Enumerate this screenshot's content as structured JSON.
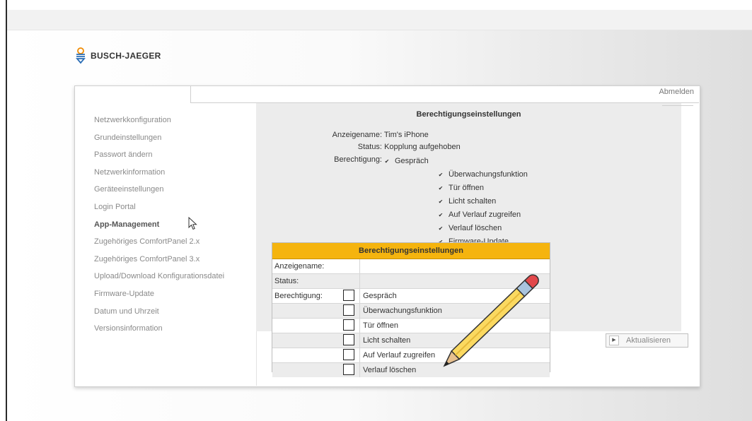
{
  "brand": {
    "name": "BUSCH-JAEGER"
  },
  "header": {
    "logout_label": "Abmelden"
  },
  "sidebar": {
    "items": [
      {
        "label": "Netzwerkkonfiguration"
      },
      {
        "label": "Grundeinstellungen"
      },
      {
        "label": "Passwort ändern"
      },
      {
        "label": "Netzwerkinformation"
      },
      {
        "label": "Geräteeinstellungen"
      },
      {
        "label": "Login Portal"
      },
      {
        "label": "App-Management",
        "active": true
      },
      {
        "label": "Zugehöriges ComfortPanel 2.x"
      },
      {
        "label": "Zugehöriges ComfortPanel 3.x"
      },
      {
        "label": "Upload/Download Konfigurationsdatei"
      },
      {
        "label": "Firmware-Update"
      },
      {
        "label": "Datum und Uhrzeit"
      },
      {
        "label": "Versionsinformation"
      }
    ]
  },
  "main": {
    "title": "Berechtigungseinstellungen",
    "display_name_label": "Anzeigename:",
    "display_name_value": "Tim's iPhone",
    "status_label": "Status:",
    "status_value": "Kopplung aufgehoben",
    "permission_label": "Berechtigung:",
    "permissions": [
      {
        "label": "Gespräch",
        "checked": true
      },
      {
        "label": "Überwachungsfunktion",
        "checked": true
      },
      {
        "label": "Tür öffnen",
        "checked": true
      },
      {
        "label": "Licht schalten",
        "checked": true
      },
      {
        "label": "Auf Verlauf zugreifen",
        "checked": true
      },
      {
        "label": "Verlauf löschen",
        "checked": true
      },
      {
        "label": "Firmware-Update",
        "checked": true
      }
    ],
    "refresh_label": "Aktualisieren"
  },
  "overlay_table": {
    "title": "Berechtigungseinstellungen",
    "rows": [
      {
        "label": "Anzeigename:",
        "value": ""
      },
      {
        "label": "Status:",
        "value": ""
      },
      {
        "label": "Berechtigung:",
        "value": "Gespräch",
        "checked": false
      },
      {
        "label": "",
        "value": "Überwachungsfunktion",
        "checked": false
      },
      {
        "label": "",
        "value": "Tür öffnen",
        "checked": false
      },
      {
        "label": "",
        "value": "Licht schalten",
        "checked": false
      },
      {
        "label": "",
        "value": "Auf Verlauf zugreifen",
        "checked": false
      },
      {
        "label": "",
        "value": "Verlauf löschen",
        "checked": false
      }
    ]
  },
  "colors": {
    "accent": "#f5b40e",
    "logo_blue": "#2a6db5",
    "logo_orange": "#f08a00"
  },
  "icons": {
    "pencil": "pencil-icon",
    "cursor": "mouse-pointer-icon",
    "checkbox": "checkbox-icon",
    "refresh": "play-triangle-icon"
  }
}
